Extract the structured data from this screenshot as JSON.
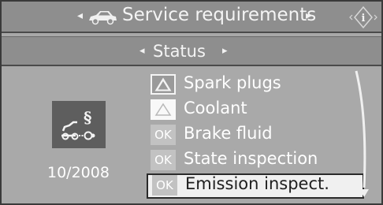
{
  "header": {
    "title": "Service requirements",
    "left_arrow": "◂",
    "right_arrow": "▸",
    "car_icon": "car-icon",
    "info_icon": "info-icon"
  },
  "subheader": {
    "title": "Status",
    "left_arrow": "◂",
    "right_arrow": "▸"
  },
  "status_panel": {
    "icon": "emission-inspection-icon",
    "date": "10/2008"
  },
  "items": [
    {
      "label": "Spark plugs",
      "badge": "warning-triangle-filled"
    },
    {
      "label": "Coolant",
      "badge": "warning-triangle-outline"
    },
    {
      "label": "Brake fluid",
      "badge": "ok",
      "badge_text": "OK"
    },
    {
      "label": "State inspection",
      "badge": "ok",
      "badge_text": "OK"
    },
    {
      "label": "Emission inspect.",
      "badge": "ok",
      "badge_text": "OK",
      "selected": true
    }
  ],
  "colors": {
    "background": "#a9a9a9",
    "header": "#8e8e8e",
    "selected_row": "#f0f0f0",
    "text": "#ffffff"
  }
}
